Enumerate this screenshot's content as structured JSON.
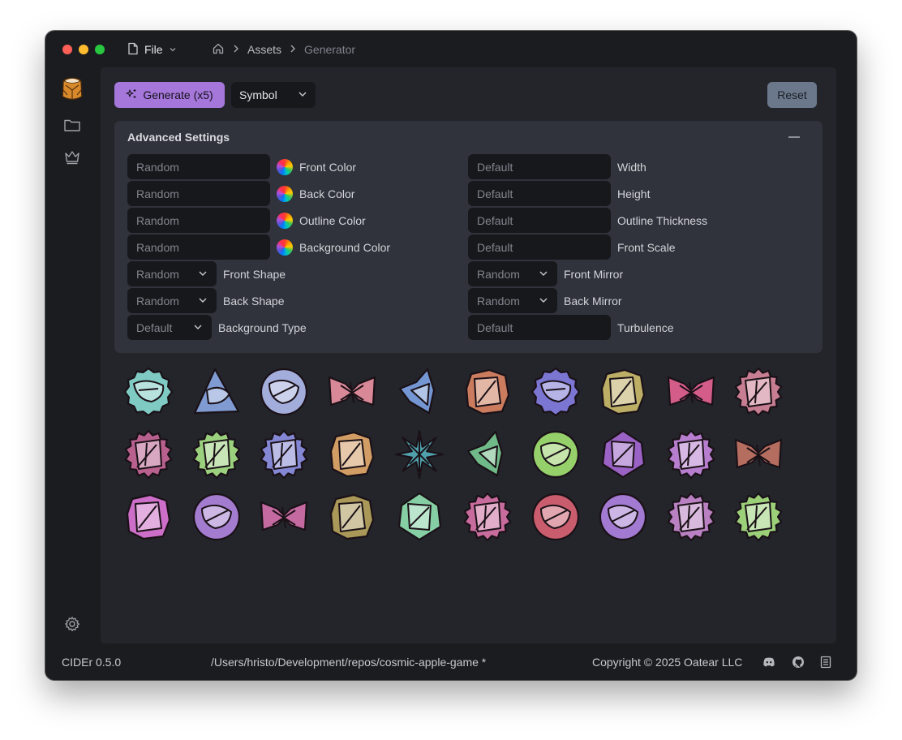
{
  "titlebar": {
    "file_label": "File",
    "breadcrumbs": [
      "Assets",
      "Generator"
    ]
  },
  "toolbar": {
    "generate_label": "Generate (x5)",
    "symbol_select": "Symbol",
    "reset_label": "Reset"
  },
  "advanced": {
    "title": "Advanced Settings",
    "left": [
      {
        "value": "Random",
        "label": "Front Color",
        "kind": "color"
      },
      {
        "value": "Random",
        "label": "Back Color",
        "kind": "color"
      },
      {
        "value": "Random",
        "label": "Outline Color",
        "kind": "color"
      },
      {
        "value": "Random",
        "label": "Background Color",
        "kind": "color"
      },
      {
        "value": "Random",
        "label": "Front Shape",
        "kind": "select"
      },
      {
        "value": "Random",
        "label": "Back Shape",
        "kind": "select"
      },
      {
        "value": "Default",
        "label": "Background Type",
        "kind": "select"
      }
    ],
    "right": [
      {
        "value": "Default",
        "label": "Width",
        "kind": "text"
      },
      {
        "value": "Default",
        "label": "Height",
        "kind": "text"
      },
      {
        "value": "Default",
        "label": "Outline Thickness",
        "kind": "text"
      },
      {
        "value": "Default",
        "label": "Front Scale",
        "kind": "text"
      },
      {
        "value": "Random",
        "label": "Front Mirror",
        "kind": "select"
      },
      {
        "value": "Random",
        "label": "Back Mirror",
        "kind": "select"
      },
      {
        "value": "Default",
        "label": "Turbulence",
        "kind": "text"
      }
    ]
  },
  "symbols": [
    {
      "shape": "badge",
      "color": "#7fcbc4"
    },
    {
      "shape": "triangle",
      "color": "#7f9bd1"
    },
    {
      "shape": "circle",
      "color": "#a3addc"
    },
    {
      "shape": "bowtie",
      "color": "#d98897"
    },
    {
      "shape": "wing",
      "color": "#7496d2"
    },
    {
      "shape": "square",
      "color": "#cc7c5e"
    },
    {
      "shape": "badge",
      "color": "#7b76d2"
    },
    {
      "shape": "square",
      "color": "#bdae66"
    },
    {
      "shape": "bowtie",
      "color": "#d45c88"
    },
    {
      "shape": "star",
      "color": "#c87e92"
    },
    {
      "shape": "star",
      "color": "#b8608e"
    },
    {
      "shape": "star",
      "color": "#9bd07e"
    },
    {
      "shape": "star",
      "color": "#8487d4"
    },
    {
      "shape": "square",
      "color": "#d19d64"
    },
    {
      "shape": "spiky",
      "color": "#4fa0ac"
    },
    {
      "shape": "wing",
      "color": "#6fba88"
    },
    {
      "shape": "circle",
      "color": "#95d06a"
    },
    {
      "shape": "diamond",
      "color": "#9a62c4"
    },
    {
      "shape": "star",
      "color": "#b77ed0"
    },
    {
      "shape": "bowtie",
      "color": "#b56d60"
    },
    {
      "shape": "square",
      "color": "#cd6ec8"
    },
    {
      "shape": "circle",
      "color": "#a47ccf"
    },
    {
      "shape": "bowtie",
      "color": "#c46aa0"
    },
    {
      "shape": "square",
      "color": "#a99858"
    },
    {
      "shape": "diamond",
      "color": "#86cfa4"
    },
    {
      "shape": "star",
      "color": "#c86b9d"
    },
    {
      "shape": "circle",
      "color": "#c95d6d"
    },
    {
      "shape": "circle",
      "color": "#a27ad2"
    },
    {
      "shape": "star",
      "color": "#b980c2"
    },
    {
      "shape": "star",
      "color": "#9bd079"
    }
  ],
  "footer": {
    "version": "CIDEr 0.5.0",
    "path": "/Users/hristo/Development/repos/cosmic-apple-game *",
    "copyright": "Copyright © 2025 Oatear LLC"
  },
  "colors": {
    "accent": "#a577da",
    "reset": "#6b788c",
    "main_bg": "#23252b",
    "panel_bg": "#30333b"
  }
}
